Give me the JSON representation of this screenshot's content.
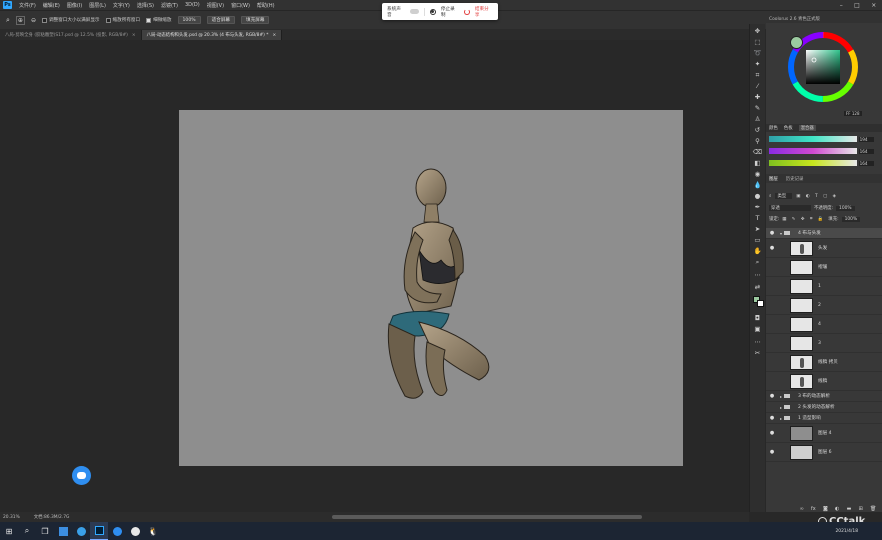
{
  "menu": {
    "logo": "Ps",
    "items": [
      "文件(F)",
      "编辑(E)",
      "图像(I)",
      "图层(L)",
      "文字(Y)",
      "选择(S)",
      "滤镜(T)",
      "3D(D)",
      "视图(V)",
      "窗口(W)",
      "帮助(H)"
    ]
  },
  "options": {
    "resize_label": "调整窗口大小以满屏显示",
    "zoom_all_label": "缩放所有窗口",
    "scrubby_label": "细微缩放",
    "zoom_pct": "100%",
    "fit_screen": "适合屏幕",
    "fill_screen": "填充屏幕"
  },
  "recorder": {
    "sound_label": "系统声音",
    "stop_label": "停止录制",
    "share_label": "结束分享"
  },
  "tabs": [
    {
      "label": "八局-剪映全身 (胶粘雕塑)S17.psd @ 12.5% (投影, RGB/8#)",
      "active": false
    },
    {
      "label": "八局-动态结构和头发.psd @ 20.3% (4 布与头发, RGB/8#) *",
      "active": true
    }
  ],
  "status": {
    "zoom": "20.31%",
    "doc": "文档:86.3M/2.7G"
  },
  "color_panel": {
    "header": "Coolorus 2.6 青色正式版",
    "hex": "FF 128",
    "tabs": [
      "颜色",
      "色板",
      "混合器"
    ],
    "sliders": [
      {
        "value": "194",
        "gradient": "linear-gradient(90deg,#2f9fa8,#3fe6c6,#e8e8e8)"
      },
      {
        "value": "164",
        "gradient": "linear-gradient(90deg,#8a2be2,#d04ad0,#e8e8e8)"
      },
      {
        "value": "164",
        "gradient": "linear-gradient(90deg,#7fbf1f,#c8e61e,#e8e8e8)"
      }
    ]
  },
  "layers_panel": {
    "tabs": [
      "图层",
      "历史记录"
    ],
    "filter": "类型",
    "blend_mode": "穿透",
    "opacity_label": "不透明度:",
    "opacity_value": "100%",
    "lock_label": "锁定:",
    "fill_label": "填充:",
    "fill_value": "100%",
    "layers": [
      {
        "name": "4 布与头发",
        "kind": "group",
        "visible": true,
        "open": true
      },
      {
        "name": "头发",
        "kind": "layer",
        "visible": true,
        "thumb": "figure"
      },
      {
        "name": "褶皱",
        "kind": "layer",
        "visible": false,
        "thumb": "blank"
      },
      {
        "name": "1",
        "kind": "layer",
        "visible": false,
        "thumb": "blank"
      },
      {
        "name": "2",
        "kind": "layer",
        "visible": false,
        "thumb": "blank"
      },
      {
        "name": "4",
        "kind": "layer",
        "visible": false,
        "thumb": "blank"
      },
      {
        "name": "3",
        "kind": "layer",
        "visible": false,
        "thumb": "blank"
      },
      {
        "name": "线稿 拷贝",
        "kind": "layer",
        "visible": false,
        "thumb": "figure"
      },
      {
        "name": "线稿",
        "kind": "layer",
        "visible": false,
        "thumb": "figure"
      },
      {
        "name": "3 布的动态解析",
        "kind": "group",
        "visible": true,
        "open": false
      },
      {
        "name": "2 头发的动态解析",
        "kind": "group",
        "visible": false,
        "open": false
      },
      {
        "name": "1 造型影响",
        "kind": "group",
        "visible": true,
        "open": false
      },
      {
        "name": "图层 4",
        "kind": "layer",
        "visible": true,
        "thumb": "gray"
      },
      {
        "name": "图层 6",
        "kind": "layer",
        "visible": true,
        "thumb": "light"
      }
    ]
  },
  "watermark": "CCtalk",
  "taskbar": {
    "date": "2021/4/18"
  },
  "colors": {
    "ps_blue": "#31a8ff",
    "canvas_bg": "#8e8e8e",
    "panel_bg": "#383838",
    "selected_layer": "#4a4a4a",
    "share_red": "#e23b3b"
  }
}
